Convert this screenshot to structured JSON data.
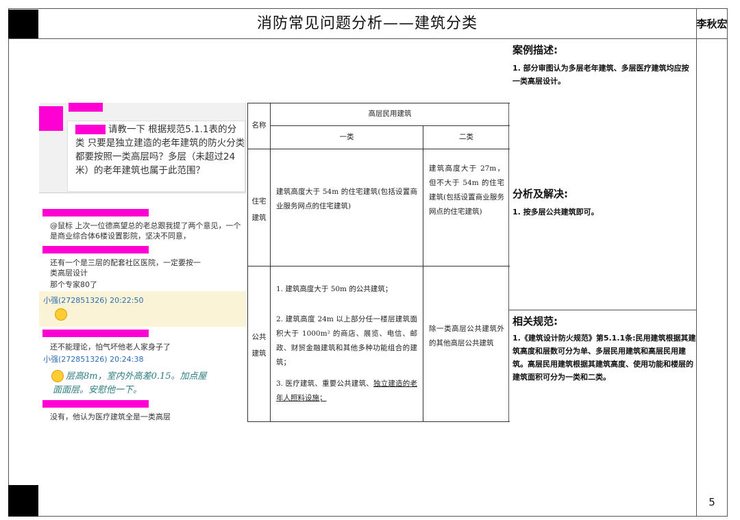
{
  "page": {
    "title": "消防常见问题分析——建筑分类",
    "author": "李秋宏",
    "page_number": "5"
  },
  "case": {
    "heading": "案例描述:",
    "text": "1. 部分审图认为多层老年建筑、多层医疗建筑均应按一类高层设计。"
  },
  "analysis": {
    "heading": "分析及解决:",
    "text": "1. 按多层公共建筑即可。"
  },
  "norms": {
    "heading": "相关规范:",
    "text": "1.《建筑设计防火规范》第5.1.1条:民用建筑根据其建筑高度和层数可分为单、多层民用建筑和高层民用建筑。高层民用建筑根据其建筑高度、使用功能和楼层的建筑面积可分为一类和二类。"
  },
  "chat": {
    "question": "请教一下 根据规范5.1.1表的分类 只要是独立建造的老年建筑的防火分类都要按照一类高层吗？多层（未超过24米）的老年建筑也属于此范围？",
    "msg1": "@鼠标 上次一位德高望总的老总跟我提了两个意见，一个是商业综合体6楼设置影院，坚决不同意，",
    "msg2a": "还有一个是三层的配套社区医院，一定要按一类高层设计",
    "msg2b": "那个专家80了",
    "name1": "小强(272851326) 20:22:50",
    "msg3": "还不能理论，怕气坏他老人家身子了",
    "name2": "小强(272851326) 20:24:38",
    "hand1": "层高8m，室内外高差0.15。加点屋",
    "hand2": "面面层。安慰他一下。",
    "msg4": "没有，他认为医疗建筑全是一类高层"
  },
  "table": {
    "col_name": "名称",
    "col_group": "高层民用建筑",
    "col_class1": "一类",
    "col_class2": "二类",
    "row1_label": "住宅建筑",
    "row1_c1": "建筑高度大于 54m 的住宅建筑(包括设置商业服务网点的住宅建筑)",
    "row1_c2": "建筑高度大于 27m，但不大于 54m 的住宅建筑(包括设置商业服务网点的住宅建筑)",
    "row2_label": "公共建筑",
    "row2_c1_1": "1. 建筑高度大于 50m 的公共建筑；",
    "row2_c1_2": "2. 建筑高度 24m 以上部分任一楼层建筑面积大于 1000m² 的商店、展览、电信、邮政、财贸金融建筑和其他多种功能组合的建筑；",
    "row2_c1_3a": "3. 医疗建筑、重要公共建筑、",
    "row2_c1_3b": "独立建造的老年人照料设施；",
    "row2_c2": "除一类高层公共建筑外的其他高层公共建筑"
  }
}
